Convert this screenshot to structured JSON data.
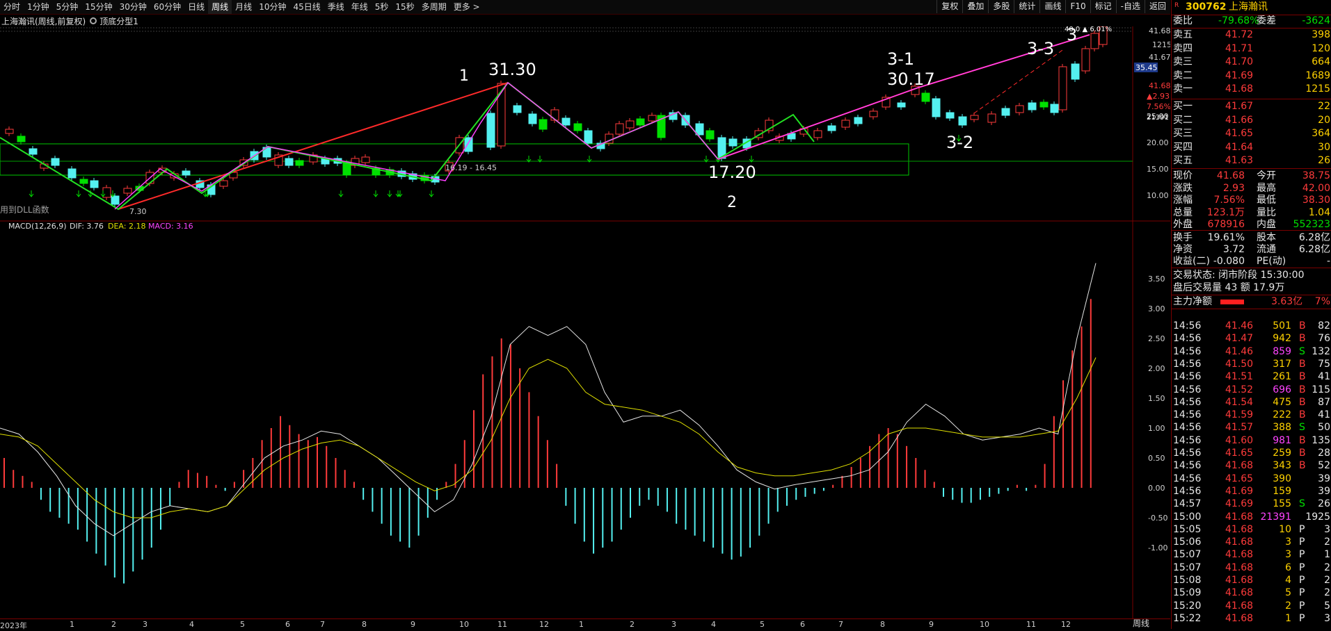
{
  "toolbar": {
    "period_tabs": [
      "分时",
      "1分钟",
      "5分钟",
      "15分钟",
      "30分钟",
      "60分钟",
      "日线",
      "周线",
      "月线",
      "10分钟",
      "45日线",
      "季线",
      "年线",
      "5秒",
      "15秒",
      "多周期",
      "更多 >"
    ],
    "active_tab": "周线",
    "buttons": [
      "复权",
      "叠加",
      "多股",
      "统计",
      "画线",
      "F10",
      "标记",
      "-自选",
      "返回"
    ]
  },
  "header": {
    "stock_label": "上海瀚讯(周线,前复权)",
    "formula_label": "顶底分型1"
  },
  "main_chart": {
    "annotations": {
      "label_1": "1",
      "label_31_30": "31.30",
      "label_2": "2",
      "label_17_20": "17.20",
      "label_3_1": "3-1",
      "label_30_17": "30.17",
      "label_3_2": "3-2",
      "label_3_3": "3-3",
      "label_3": "3",
      "low_label": "7.30",
      "box_label": "16.19 - 16.45",
      "dll_text": "用到DLL函数"
    },
    "price_axis": [
      "25.00",
      "20.00",
      "15.00",
      "10.00"
    ],
    "right_info": {
      "p1": "41.68",
      "p2": "1215",
      "p3": "41.67",
      "current_tag": "35.45",
      "p4": "41.68",
      "change": "▲2.93",
      "pct": "7.56%",
      "vol": "21391",
      "top_note": "40.0 ▲ 6.01%"
    }
  },
  "macd": {
    "title": "MACD(12,26,9)",
    "dif_label": "DIF: 3.76",
    "dea_label": "DEA: 2.18",
    "macd_label": "MACD: 3.16",
    "axis": [
      "3.50",
      "3.00",
      "2.50",
      "2.00",
      "1.50",
      "1.00",
      "0.50",
      "0.00",
      "-0.50",
      "-1.00"
    ]
  },
  "time_axis": [
    "2023年",
    "1",
    "2",
    "3",
    "4",
    "5",
    "6",
    "7",
    "8",
    "9",
    "10",
    "11",
    "12",
    "1",
    "2",
    "3",
    "4",
    "5",
    "6",
    "7",
    "8",
    "9",
    "10",
    "11",
    "12"
  ],
  "weekline_tab": "周线",
  "quote": {
    "code": "300762",
    "name": "上海瀚讯",
    "webi_label": "委比",
    "webi": "-79.68%",
    "wecha_label": "委差",
    "wecha": "-3624",
    "asks": [
      {
        "label": "卖五",
        "price": "41.72",
        "vol": "398"
      },
      {
        "label": "卖四",
        "price": "41.71",
        "vol": "120"
      },
      {
        "label": "卖三",
        "price": "41.70",
        "vol": "664"
      },
      {
        "label": "卖二",
        "price": "41.69",
        "vol": "1689"
      },
      {
        "label": "卖一",
        "price": "41.68",
        "vol": "1215"
      }
    ],
    "bids": [
      {
        "label": "买一",
        "price": "41.67",
        "vol": "22"
      },
      {
        "label": "买二",
        "price": "41.66",
        "vol": "20"
      },
      {
        "label": "买三",
        "price": "41.65",
        "vol": "364"
      },
      {
        "label": "买四",
        "price": "41.64",
        "vol": "30"
      },
      {
        "label": "买五",
        "price": "41.63",
        "vol": "26"
      }
    ],
    "stats": [
      {
        "l1": "现价",
        "v1": "41.68",
        "l2": "今开",
        "v2": "38.75"
      },
      {
        "l1": "涨跌",
        "v1": "2.93",
        "l2": "最高",
        "v2": "42.00"
      },
      {
        "l1": "涨幅",
        "v1": "7.56%",
        "l2": "最低",
        "v2": "38.30"
      },
      {
        "l1": "总量",
        "v1": "123.1万",
        "l2": "量比",
        "v2": "1.04"
      },
      {
        "l1": "外盘",
        "v1": "678916",
        "l2": "内盘",
        "v2": "552323"
      }
    ],
    "stats2": [
      {
        "l1": "换手",
        "v1": "19.61%",
        "l2": "股本",
        "v2": "6.28亿"
      },
      {
        "l1": "净资",
        "v1": "3.72",
        "l2": "流通",
        "v2": "6.28亿"
      },
      {
        "l1": "收益(二)",
        "v1": "-0.080",
        "l2": "PE(动)",
        "v2": "-"
      }
    ],
    "trade_status": "交易状态: 闭市阶段 15:30:00",
    "after_hours": "盘后交易量 43 额 17.9万",
    "main_fund_label": "主力净额",
    "main_fund_value": "3.63亿",
    "main_fund_pct": "7%",
    "ticks": [
      {
        "t": "14:56",
        "p": "41.46",
        "v": "501",
        "d": "B",
        "n": "82"
      },
      {
        "t": "14:56",
        "p": "41.47",
        "v": "942",
        "d": "B",
        "n": "76"
      },
      {
        "t": "14:56",
        "p": "41.46",
        "v": "859",
        "d": "S",
        "n": "132"
      },
      {
        "t": "14:56",
        "p": "41.50",
        "v": "317",
        "d": "B",
        "n": "75"
      },
      {
        "t": "14:56",
        "p": "41.51",
        "v": "261",
        "d": "B",
        "n": "41"
      },
      {
        "t": "14:56",
        "p": "41.52",
        "v": "696",
        "d": "B",
        "n": "115"
      },
      {
        "t": "14:56",
        "p": "41.54",
        "v": "475",
        "d": "B",
        "n": "87"
      },
      {
        "t": "14:56",
        "p": "41.59",
        "v": "222",
        "d": "B",
        "n": "41"
      },
      {
        "t": "14:56",
        "p": "41.57",
        "v": "388",
        "d": "S",
        "n": "50"
      },
      {
        "t": "14:56",
        "p": "41.60",
        "v": "981",
        "d": "B",
        "n": "135"
      },
      {
        "t": "14:56",
        "p": "41.65",
        "v": "259",
        "d": "B",
        "n": "28"
      },
      {
        "t": "14:56",
        "p": "41.68",
        "v": "343",
        "d": "B",
        "n": "52"
      },
      {
        "t": "14:56",
        "p": "41.65",
        "v": "390",
        "d": "",
        "n": "39"
      },
      {
        "t": "14:56",
        "p": "41.69",
        "v": "159",
        "d": "",
        "n": "39"
      },
      {
        "t": "14:57",
        "p": "41.69",
        "v": "155",
        "d": "S",
        "n": "26"
      },
      {
        "t": "15:00",
        "p": "41.68",
        "v": "21391",
        "d": "",
        "n": "1925"
      },
      {
        "t": "15:05",
        "p": "41.68",
        "v": "10",
        "d": "P",
        "n": "3"
      },
      {
        "t": "15:06",
        "p": "41.68",
        "v": "3",
        "d": "P",
        "n": "2"
      },
      {
        "t": "15:07",
        "p": "41.68",
        "v": "3",
        "d": "P",
        "n": "1"
      },
      {
        "t": "15:07",
        "p": "41.68",
        "v": "6",
        "d": "P",
        "n": "2"
      },
      {
        "t": "15:08",
        "p": "41.68",
        "v": "4",
        "d": "P",
        "n": "2"
      },
      {
        "t": "15:09",
        "p": "41.68",
        "v": "5",
        "d": "P",
        "n": "2"
      },
      {
        "t": "15:20",
        "p": "41.68",
        "v": "2",
        "d": "P",
        "n": "5"
      },
      {
        "t": "15:22",
        "p": "41.68",
        "v": "1",
        "d": "P",
        "n": "3"
      }
    ]
  },
  "colors": {
    "up": "#ff3b3b",
    "down": "#00e000",
    "down_cyan": "#54f0f0",
    "dif": "#e6e6e6",
    "dea": "#e0e000",
    "grid": "#7a0000"
  }
}
